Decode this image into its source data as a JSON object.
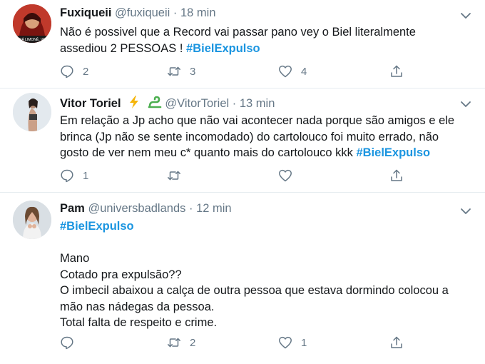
{
  "tweets": [
    {
      "name": "Fuxiqueii",
      "handle": "@fuxiqueii",
      "time": "18 min",
      "separator": "·",
      "avatar_caption": "DÁ LIMONÊ, VA",
      "lines": [
        "Não é possivel que a Record vai passar pano vey o Biel literalmente",
        "assediou 2 PESSOAS ! "
      ],
      "hashtag": "#BielExpulso",
      "replies": "2",
      "retweets": "3",
      "likes": "4"
    },
    {
      "name": "Vitor Toriel",
      "handle": "@VitorToriel",
      "time": "13 min",
      "separator": "·",
      "badges": [
        "lightning-emoji",
        "green-snake-emoji"
      ],
      "lines": [
        "Em relação a Jp acho que não vai acontecer nada porque são amigos e ele",
        "brinca (Jp não se sente incomodado) do cartolouco foi muito errado, não",
        "gosto de ver nem meu c* quanto mais do cartolouco kkk "
      ],
      "hashtag": "#BielExpulso",
      "replies": "1",
      "retweets": "",
      "likes": ""
    },
    {
      "name": "Pam",
      "handle": "@universbadlands",
      "time": "12 min",
      "separator": "·",
      "hashtag": "#BielExpulso",
      "lines": [
        "Mano",
        "Cotado pra expulsão??",
        "O imbecil abaixou a calça de outra pessoa que estava dormindo colocou a",
        "mão nas nádegas da pessoa.",
        "Total falta de respeito e crime."
      ],
      "replies": "",
      "retweets": "2",
      "likes": "1"
    }
  ],
  "colors": {
    "text": "#14171a",
    "muted": "#657786",
    "hashtag": "#1b95e0",
    "divider": "#e6ecf0"
  },
  "icons": [
    "chevron-down-icon",
    "reply-icon",
    "retweet-icon",
    "like-icon",
    "share-icon"
  ]
}
